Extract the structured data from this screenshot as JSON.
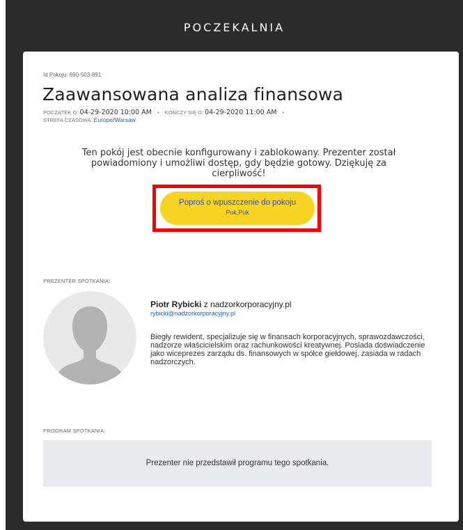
{
  "header": {
    "title": "POCZEKALNIA"
  },
  "room": {
    "id_label": "Id Pokoju:",
    "id_value": "690-503-891",
    "title": "Zaawansowana analiza finansowa",
    "start_label": "POCZĄTEK O:",
    "start_value": "04-29-2020 10:00 AM",
    "end_label": "KOŃCZY SIĘ O:",
    "end_value": "04-29-2020 11:00 AM",
    "timezone_label": "STREFA CZASOWA:",
    "timezone_value": "Europe/Warsaw"
  },
  "status_message": "Ten pokój jest obecnie konfigurowany i zablokowany. Prezenter został powiadomiony i umożliwi dostęp, gdy będzie gotowy. Dziękuję za cierpliwość!",
  "knock_button": {
    "label": "Poproś o wpuszczenie do pokoju",
    "sublabel": "Puk,Puk"
  },
  "presenter": {
    "section_label": "PREZENTER SPOTKANIA:",
    "name": "Piotr Rybicki",
    "connector": "z",
    "organization": "nadzorkorporacyjny.pl",
    "email": "rybicki@nadzorkorporacyjny.pl",
    "bio": "Biegły rewident, specjalizuje się w finansach korporacyjnych, sprawozdawczości, nadzorze właścicielskim oraz rachunkowości kreatywnej. Posiada doświadczenie jako wiceprezes zarządu ds. finansowych w spółce giełdowej, zasiada w radach nadzorczych.",
    "avatar_icon": "user-silhouette-icon"
  },
  "agenda": {
    "section_label": "PROGRAM SPOTKANIA:",
    "empty_message": "Prezenter nie przedstawił programu tego spotkania."
  },
  "colors": {
    "background": "#2b2b2b",
    "button": "#f9d523",
    "highlight": "#ff0000",
    "link": "#2a5bd7",
    "agenda_bg": "#e8ebef"
  }
}
